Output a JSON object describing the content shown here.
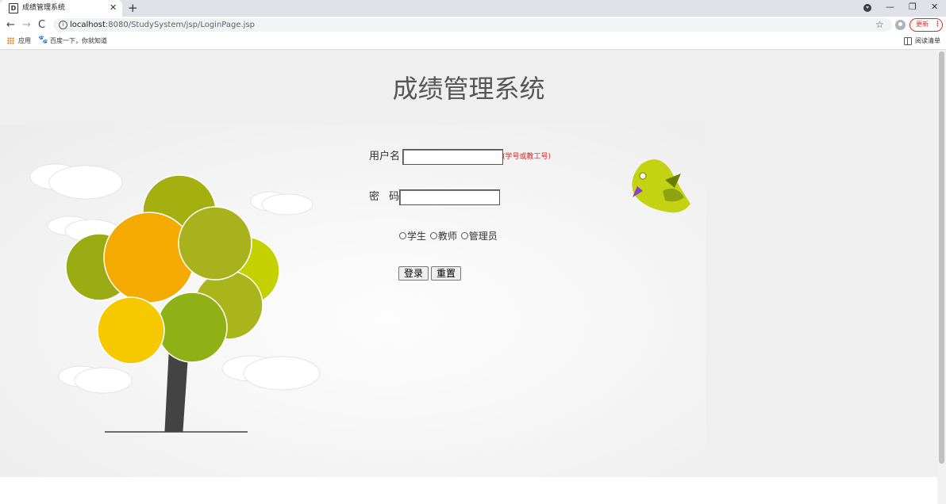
{
  "browser": {
    "tab_title": "成绩管理系统",
    "tab_favicon_letter": "D",
    "tab_close": "✕",
    "new_tab": "+",
    "url_host": "localhost",
    "url_rest": ":8080/StudySystem/jsp/LoginPage.jsp",
    "update_label": "更新",
    "update_dots": "⋮",
    "window_min": "—",
    "window_max": "❐",
    "window_close": "✕",
    "back": "←",
    "forward": "→",
    "reload": "C",
    "star": "☆",
    "info": "i"
  },
  "bookmarks": {
    "apps": "应用",
    "baidu": "百度一下，你就知道",
    "reading_list": "阅读清单"
  },
  "page": {
    "title": "成绩管理系统",
    "username_label": "用户名",
    "password_label": "密 码",
    "username_hint": "(学号或教工号)",
    "username_value": "",
    "password_value": "",
    "roles": [
      "学生",
      "教师",
      "管理员"
    ],
    "login_button": "登录",
    "reset_button": "重置"
  },
  "colors": {
    "hint": "#cc2a2a",
    "update_accent": "#d93025",
    "panel_bg": "#efefef"
  }
}
